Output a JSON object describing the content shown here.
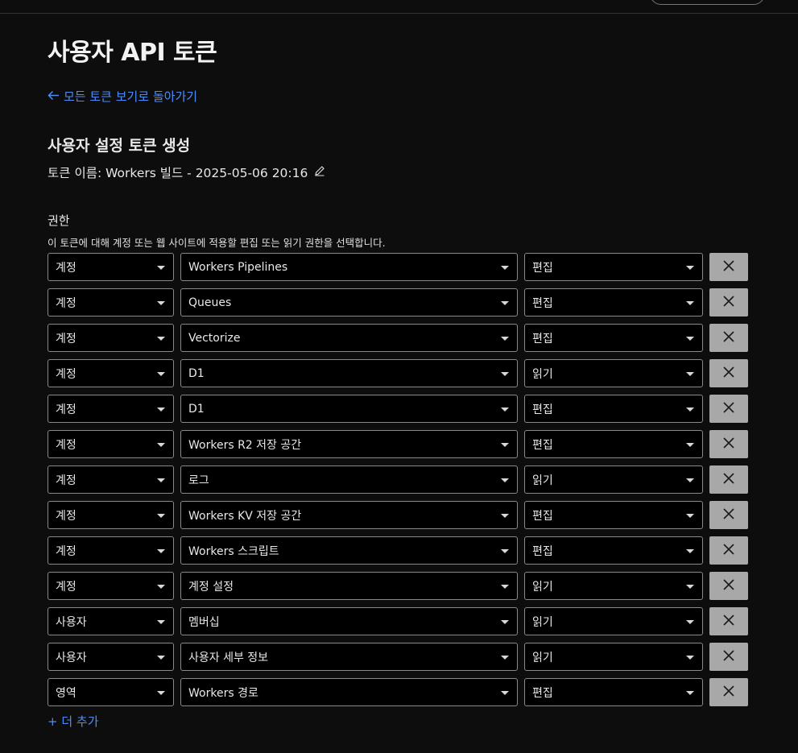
{
  "page": {
    "title": "사용자 API 토큰",
    "back_link": "모든 토큰 보기로 돌아가기",
    "section_title": "사용자 설정 토큰 생성",
    "token_name": "토큰 이름: Workers 빌드 - 2025-05-06 20:16",
    "permissions_label": "권한",
    "permissions_description": "이 토큰에 대해 계정 또는 웹 사이트에 적용할 편집 또는 읽기 권한을 선택합니다.",
    "add_more": "+ 더 추가"
  },
  "icons": {
    "back": "arrow-left-icon",
    "edit": "pencil-icon",
    "remove": "close-icon",
    "dropdown": "caret-down-icon"
  },
  "colors": {
    "link": "#4d8df7",
    "background": "#0d0d0d",
    "remove_button": "#a8a8a8"
  },
  "permissions": [
    {
      "scope": "계정",
      "item": "Workers Pipelines",
      "access": "편집"
    },
    {
      "scope": "계정",
      "item": "Queues",
      "access": "편집"
    },
    {
      "scope": "계정",
      "item": "Vectorize",
      "access": "편집"
    },
    {
      "scope": "계정",
      "item": "D1",
      "access": "읽기"
    },
    {
      "scope": "계정",
      "item": "D1",
      "access": "편집"
    },
    {
      "scope": "계정",
      "item": "Workers R2 저장 공간",
      "access": "편집"
    },
    {
      "scope": "계정",
      "item": "로그",
      "access": "읽기"
    },
    {
      "scope": "계정",
      "item": "Workers KV 저장 공간",
      "access": "편집"
    },
    {
      "scope": "계정",
      "item": "Workers 스크립트",
      "access": "편집"
    },
    {
      "scope": "계정",
      "item": "계정 설정",
      "access": "읽기"
    },
    {
      "scope": "사용자",
      "item": "멤버십",
      "access": "읽기"
    },
    {
      "scope": "사용자",
      "item": "사용자 세부 정보",
      "access": "읽기"
    },
    {
      "scope": "영역",
      "item": "Workers 경로",
      "access": "편집"
    }
  ]
}
